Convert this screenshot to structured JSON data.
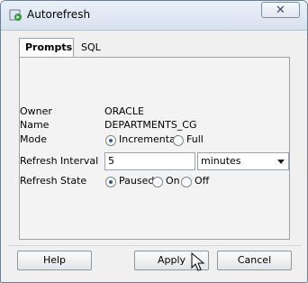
{
  "window": {
    "title": "Autorefresh",
    "close_glyph": "✕"
  },
  "tabs": [
    {
      "label": "Prompts",
      "active": true
    },
    {
      "label": "SQL",
      "active": false
    }
  ],
  "fields": {
    "owner": {
      "label": "Owner",
      "value": "ORACLE"
    },
    "name": {
      "label": "Name",
      "value": "DEPARTMENTS_CG"
    },
    "mode": {
      "label": "Mode",
      "options": [
        "Incremental",
        "Full"
      ],
      "selected": "Incremental"
    },
    "refresh_interval": {
      "label": "Refresh Interval",
      "value": "5",
      "unit": "minutes"
    },
    "refresh_state": {
      "label": "Refresh State",
      "options": [
        "Paused",
        "On",
        "Off"
      ],
      "selected": "Paused"
    }
  },
  "buttons": {
    "help": "Help",
    "apply": "Apply",
    "cancel": "Cancel"
  },
  "colors": {
    "accent": "#2e5b9a",
    "titlebar": "#dce6f2"
  }
}
